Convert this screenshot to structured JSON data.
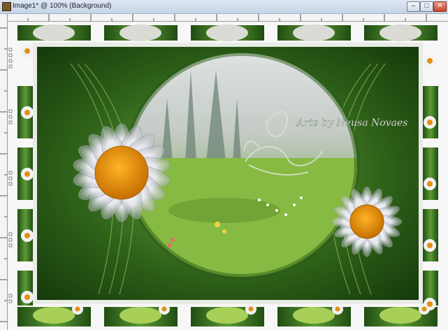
{
  "window": {
    "title": "Image1* @ 100% (Background)",
    "buttons": {
      "minimize": "–",
      "maximize": "□",
      "close": "✕"
    }
  },
  "canvas": {
    "watermark_text": "Arte by Neusa Novaes"
  },
  "colors": {
    "frame_dark_green": "#1f4d12",
    "frame_mid_green": "#4f8a2c",
    "meadow_green": "#8bbf4a",
    "fog": "#cfd5d3",
    "daisy_petal": "#f4f4f6",
    "daisy_center": "#e48f12"
  }
}
